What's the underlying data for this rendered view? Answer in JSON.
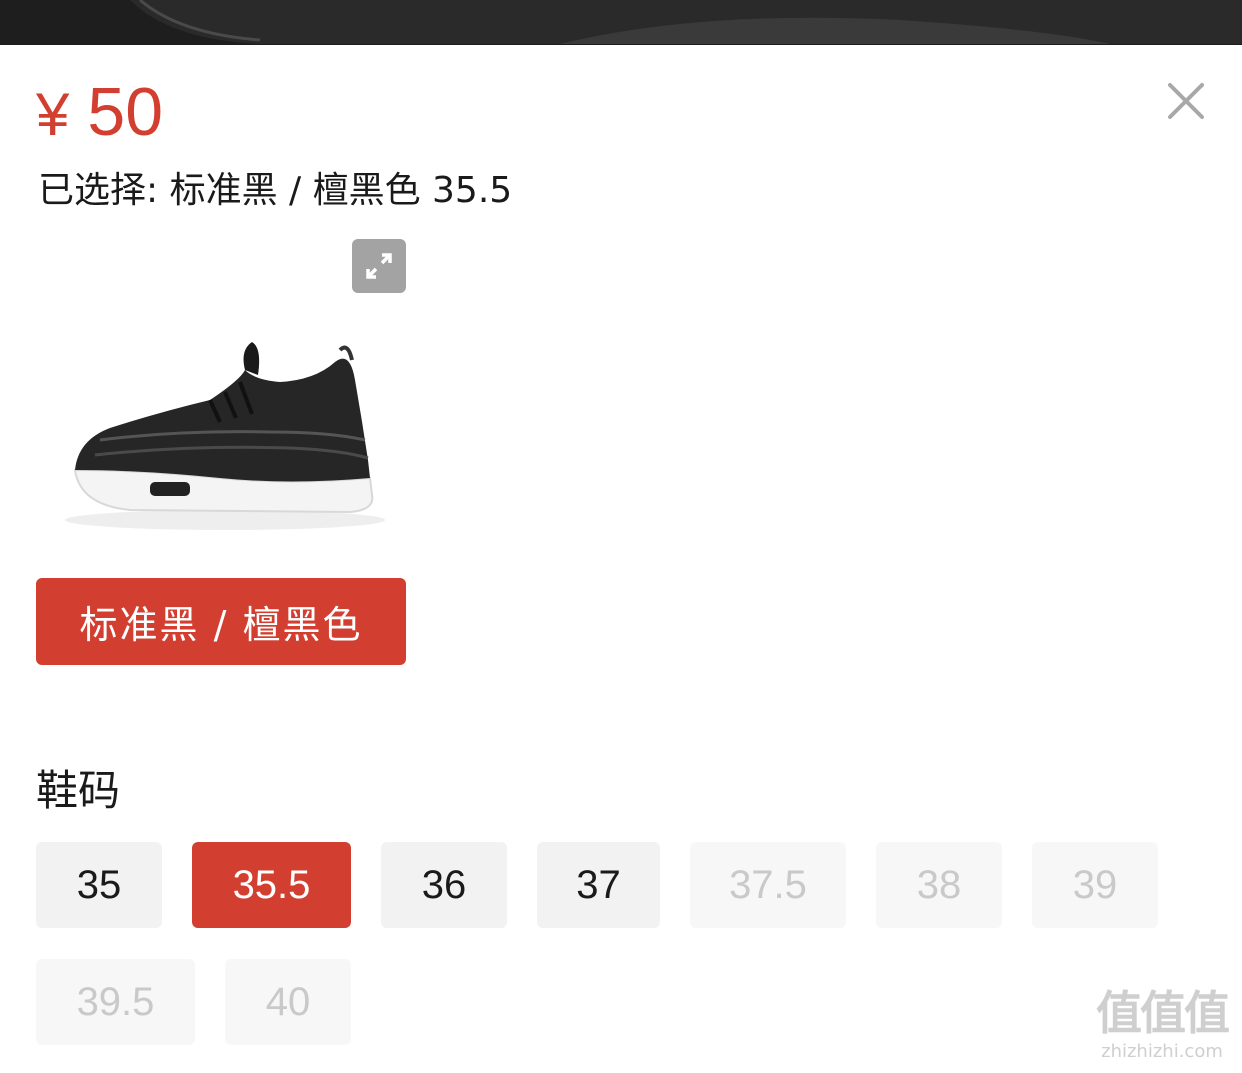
{
  "price": {
    "currency": "¥",
    "amount": "50"
  },
  "selection": {
    "text": "已选择: 标准黑 / 檀黑色 35.5"
  },
  "color_option": {
    "label": "标准黑 / 檀黑色"
  },
  "size_section": {
    "heading": "鞋码",
    "sizes": [
      {
        "label": "35",
        "state": "available"
      },
      {
        "label": "35.5",
        "state": "selected"
      },
      {
        "label": "36",
        "state": "available"
      },
      {
        "label": "37",
        "state": "available"
      },
      {
        "label": "37.5",
        "state": "disabled"
      },
      {
        "label": "38",
        "state": "disabled"
      },
      {
        "label": "39",
        "state": "disabled"
      },
      {
        "label": "39.5",
        "state": "disabled"
      },
      {
        "label": "40",
        "state": "disabled"
      }
    ]
  },
  "icons": {
    "close": "close-icon",
    "expand": "expand-icon"
  },
  "colors": {
    "accent": "#d23f31",
    "chip_bg": "#f2f2f2",
    "chip_disabled_text": "#c9c9c9"
  },
  "watermark": {
    "logo": "值值值",
    "text": "zhizhizhi.com"
  }
}
